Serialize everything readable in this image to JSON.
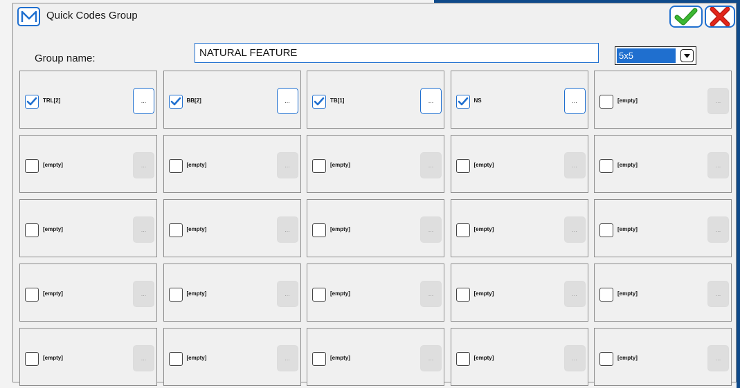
{
  "window": {
    "title": "Quick Codes Group",
    "logo_letter": "M",
    "ok_icon": "check-icon",
    "cancel_icon": "close-icon"
  },
  "form": {
    "group_label": "Group name:",
    "group_value": "NATURAL FEATURE",
    "size_value": "5x5"
  },
  "colors": {
    "accent": "#1f6fcf",
    "ok_green": "#3cb832",
    "cancel_red": "#e2261b"
  },
  "grid": {
    "more_label": "...",
    "cells": [
      {
        "label": "TRL[2]",
        "checked": true,
        "enabled": true
      },
      {
        "label": "BB[2]",
        "checked": true,
        "enabled": true
      },
      {
        "label": "TB[1]",
        "checked": true,
        "enabled": true
      },
      {
        "label": "NS",
        "checked": true,
        "enabled": true
      },
      {
        "label": "[empty]",
        "checked": false,
        "enabled": false
      },
      {
        "label": "[empty]",
        "checked": false,
        "enabled": false
      },
      {
        "label": "[empty]",
        "checked": false,
        "enabled": false
      },
      {
        "label": "[empty]",
        "checked": false,
        "enabled": false
      },
      {
        "label": "[empty]",
        "checked": false,
        "enabled": false
      },
      {
        "label": "[empty]",
        "checked": false,
        "enabled": false
      },
      {
        "label": "[empty]",
        "checked": false,
        "enabled": false
      },
      {
        "label": "[empty]",
        "checked": false,
        "enabled": false
      },
      {
        "label": "[empty]",
        "checked": false,
        "enabled": false
      },
      {
        "label": "[empty]",
        "checked": false,
        "enabled": false
      },
      {
        "label": "[empty]",
        "checked": false,
        "enabled": false
      },
      {
        "label": "[empty]",
        "checked": false,
        "enabled": false
      },
      {
        "label": "[empty]",
        "checked": false,
        "enabled": false
      },
      {
        "label": "[empty]",
        "checked": false,
        "enabled": false
      },
      {
        "label": "[empty]",
        "checked": false,
        "enabled": false
      },
      {
        "label": "[empty]",
        "checked": false,
        "enabled": false
      },
      {
        "label": "[empty]",
        "checked": false,
        "enabled": false
      },
      {
        "label": "[empty]",
        "checked": false,
        "enabled": false
      },
      {
        "label": "[empty]",
        "checked": false,
        "enabled": false
      },
      {
        "label": "[empty]",
        "checked": false,
        "enabled": false
      },
      {
        "label": "[empty]",
        "checked": false,
        "enabled": false
      }
    ]
  }
}
